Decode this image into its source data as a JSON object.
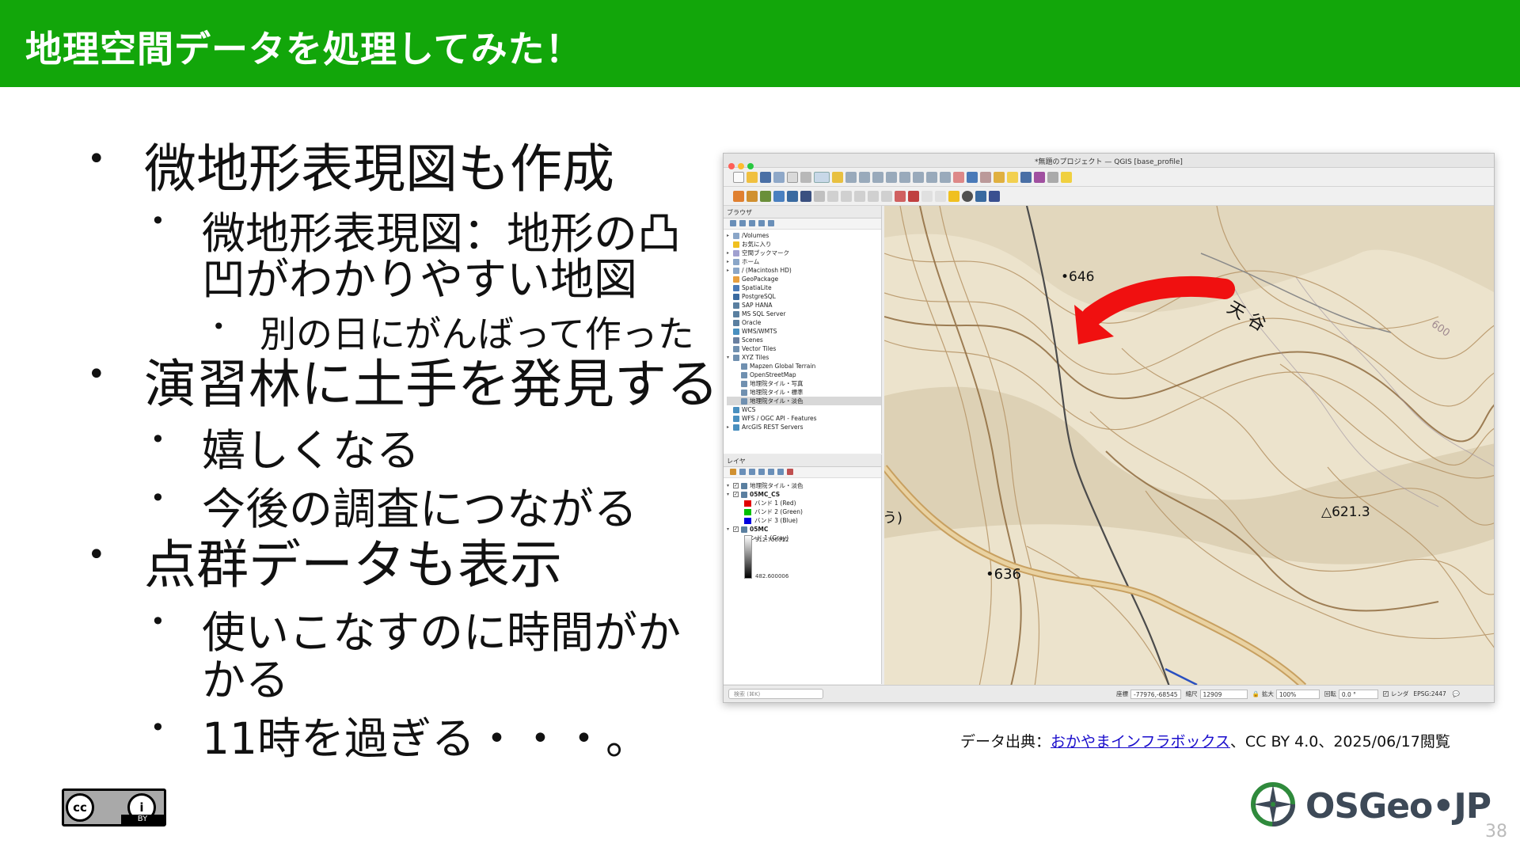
{
  "header": {
    "title": "地理空間データを処理してみた！",
    "bg_color": "#12a60a"
  },
  "bullets": [
    {
      "level": 1,
      "text": "微地形表現図も作成"
    },
    {
      "level": 2,
      "text": "微地形表現図：地形の凸"
    },
    {
      "level": 2,
      "text": "凹がわかりやすい地図",
      "continuation": true
    },
    {
      "level": 3,
      "text": "別の日にがんばって作った"
    },
    {
      "level": 1,
      "text": "演習林に土手を発見する"
    },
    {
      "level": 2,
      "text": "嬉しくなる"
    },
    {
      "level": 2,
      "text": "今後の調査につながる"
    },
    {
      "level": 1,
      "text": "点群データも表示"
    },
    {
      "level": 2,
      "text": "使いこなすのに時間がか"
    },
    {
      "level": 2,
      "text": "かる",
      "continuation": true
    },
    {
      "level": 2,
      "text": "11時を過ぎる・・・。"
    }
  ],
  "qgis": {
    "window_title": "*無題のプロジェクト — QGIS [base_profile]",
    "browser_panel_title": "ブラウザ",
    "browser_items": [
      {
        "label": "/Volumes",
        "icon": "folder-icon",
        "expand": "▸"
      },
      {
        "label": "お気に入り",
        "icon": "star-icon",
        "expand": ""
      },
      {
        "label": "空間ブックマーク",
        "icon": "bookmark-icon",
        "expand": "▸"
      },
      {
        "label": "ホーム",
        "icon": "home-icon",
        "expand": "▸"
      },
      {
        "label": "/ (Macintosh HD)",
        "icon": "folder-icon",
        "expand": "▸"
      },
      {
        "label": "GeoPackage",
        "icon": "geopackage-icon",
        "expand": ""
      },
      {
        "label": "SpatiaLite",
        "icon": "spatialite-icon",
        "expand": ""
      },
      {
        "label": "PostgreSQL",
        "icon": "postgresql-icon",
        "expand": ""
      },
      {
        "label": "SAP HANA",
        "icon": "database-icon",
        "expand": ""
      },
      {
        "label": "MS SQL Server",
        "icon": "database-icon",
        "expand": ""
      },
      {
        "label": "Oracle",
        "icon": "database-icon",
        "expand": ""
      },
      {
        "label": "WMS/WMTS",
        "icon": "globe-icon",
        "expand": ""
      },
      {
        "label": "Scenes",
        "icon": "scenes-icon",
        "expand": ""
      },
      {
        "label": "Vector Tiles",
        "icon": "grid-icon",
        "expand": ""
      },
      {
        "label": "XYZ Tiles",
        "icon": "grid-icon",
        "expand": "▾"
      },
      {
        "label": "Mapzen Global Terrain",
        "icon": "grid-icon",
        "expand": "",
        "indent": true
      },
      {
        "label": "OpenStreetMap",
        "icon": "grid-icon",
        "expand": "",
        "indent": true
      },
      {
        "label": "地理院タイル・写真",
        "icon": "grid-icon",
        "expand": "",
        "indent": true
      },
      {
        "label": "地理院タイル・標準",
        "icon": "grid-icon",
        "expand": "",
        "indent": true
      },
      {
        "label": "地理院タイル・淡色",
        "icon": "grid-icon",
        "expand": "",
        "indent": true,
        "selected": true
      },
      {
        "label": "WCS",
        "icon": "globe-icon",
        "expand": ""
      },
      {
        "label": "WFS / OGC API - Features",
        "icon": "globe-icon",
        "expand": ""
      },
      {
        "label": "ArcGIS REST Servers",
        "icon": "globe-icon",
        "expand": "▸"
      }
    ],
    "layers_panel_title": "レイヤ",
    "layers": [
      {
        "label": "地理院タイル・淡色",
        "type": "layer"
      },
      {
        "label": "05MC_CS",
        "type": "layer",
        "bold": true
      },
      {
        "label": "バンド 1 (Red)",
        "type": "band",
        "color": "#e10000"
      },
      {
        "label": "バンド 2 (Green)",
        "type": "band",
        "color": "#00c000"
      },
      {
        "label": "バンド 3 (Blue)",
        "type": "band",
        "color": "#0000e0"
      },
      {
        "label": "05MC",
        "type": "layer",
        "bold": true
      },
      {
        "label": "バンド 1 (Gray)",
        "type": "text"
      }
    ],
    "gray_max": "912.700012",
    "gray_min": "482.600006",
    "map_labels": {
      "elev1": "•646",
      "elev2": "•636",
      "elev3": "△621.3",
      "place": "天谷",
      "contour": "600",
      "fragment": "う)"
    },
    "status": {
      "search_placeholder": "検索 (⌘K)",
      "coord_label": "座標",
      "coord_value": "-77976,-68545",
      "scale_label": "縮尺",
      "scale_value": "12909",
      "zoom_label": "拡大",
      "zoom_value": "100%",
      "rotation_label": "回転",
      "rotation_value": "0.0 °",
      "render_label": "レンダ",
      "crs": "EPSG:2447"
    }
  },
  "source": {
    "prefix": "データ出典：",
    "link_text": "おかやまインフラボックス",
    "suffix": "、CC BY 4.0、2025/06/17閲覧"
  },
  "license": {
    "badge_left": "cc",
    "badge_right": "i",
    "badge_by": "BY"
  },
  "logo": {
    "text": "OSGeo•JP"
  },
  "page_number": "38"
}
